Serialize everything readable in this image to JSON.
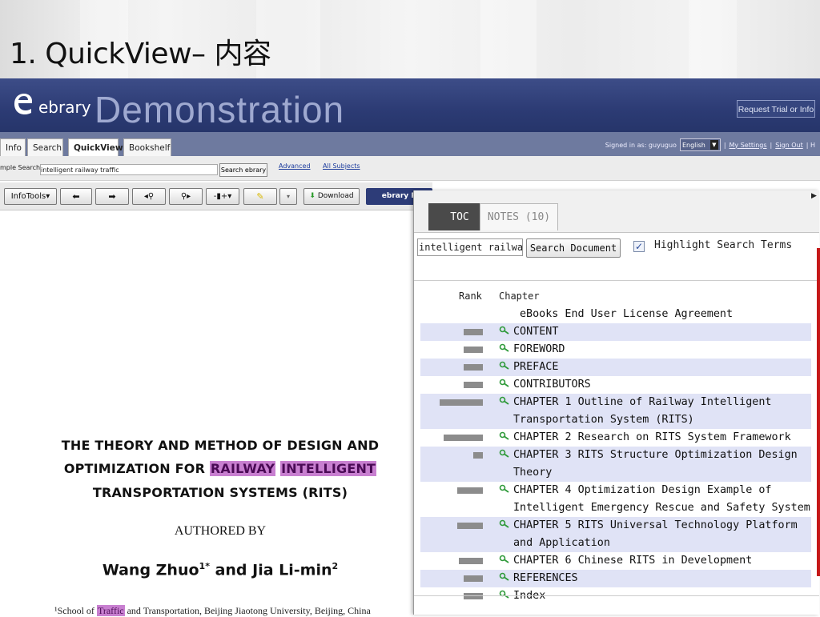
{
  "slide": {
    "title": "1. QuickView– 内容"
  },
  "banner": {
    "logo_text": "ebrary",
    "title": "Demonstration",
    "request_button": "Request Trial or Info"
  },
  "tabs": [
    "Info",
    "Search",
    "QuickView",
    "Bookshelf"
  ],
  "active_tab": "QuickView",
  "account": {
    "signed_in": "Signed in as: guyuguo",
    "language": "English",
    "settings_link": "My Settings",
    "signout_link": "Sign Out",
    "sep1": "|",
    "sep2": "|",
    "trail": "| H"
  },
  "search": {
    "label": "mple Search:",
    "value": "intelligent railway traffic",
    "button": "Search ebrary",
    "advanced": "Advanced",
    "all_subjects": "All Subjects"
  },
  "toolbar": {
    "infotools": "InfoTools",
    "download": "Download",
    "ebrary_reader": "ebrary R"
  },
  "document": {
    "title_line1": "THE THEORY AND METHOD OF DESIGN AND",
    "title_line2_prefix": "OPTIMIZATION FOR ",
    "title_hl1": "RAILWAY",
    "title_space": " ",
    "title_hl2": "INTELLIGENT",
    "title_line3": "TRANSPORTATION SYSTEMS (RITS)",
    "authored_by": "AUTHORED BY",
    "author1": "Wang Zhuo",
    "author1_sup": "1*",
    "author_and": " and ",
    "author2": "Jia Li-min",
    "author2_sup": "2",
    "affil_prefix": "¹School of ",
    "affil_hl": "Traffic",
    "affil_rest": " and Transportation, Beijing Jiaotong University, Beijing, China"
  },
  "panel": {
    "tabs": [
      "TOC",
      "NOTES (10)"
    ],
    "active_tab": "TOC",
    "search_value": "intelligent railway tr",
    "search_button": "Search Document",
    "highlight_checked": true,
    "highlight_label": "Highlight Search Terms",
    "col_rank": "Rank",
    "col_chapter": "Chapter",
    "toc": [
      {
        "title": "eBooks End User License Agreement",
        "rank": null,
        "alt": false
      },
      {
        "title": "CONTENT",
        "rank": 0.45,
        "alt": true
      },
      {
        "title": "FOREWORD",
        "rank": 0.45,
        "alt": false
      },
      {
        "title": "PREFACE",
        "rank": 0.45,
        "alt": true
      },
      {
        "title": "CONTRIBUTORS",
        "rank": 0.45,
        "alt": false
      },
      {
        "title": "CHAPTER 1 Outline of Railway Intelligent Transportation System (RITS)",
        "rank": 1.0,
        "alt": true
      },
      {
        "title": "CHAPTER 2 Research on RITS System Framework",
        "rank": 0.9,
        "alt": false
      },
      {
        "title": "CHAPTER 3 RITS Structure Optimization Design Theory",
        "rank": 0.22,
        "alt": true
      },
      {
        "title": "CHAPTER 4 Optimization Design Example of Intelligent Emergency Rescue and Safety System",
        "rank": 0.6,
        "alt": false
      },
      {
        "title": "CHAPTER 5 RITS Universal Technology Platform and Application",
        "rank": 0.6,
        "alt": true
      },
      {
        "title": "CHAPTER 6 Chinese RITS in Development",
        "rank": 0.55,
        "alt": false
      },
      {
        "title": "REFERENCES",
        "rank": 0.45,
        "alt": true
      },
      {
        "title": "Index",
        "rank": 0.45,
        "alt": false
      }
    ]
  },
  "colors": {
    "banner": "#2c3b74",
    "highlight": "#c87fd0",
    "toc_alt_row": "#e0e3f6",
    "active_tab": "#4a4a4a"
  }
}
